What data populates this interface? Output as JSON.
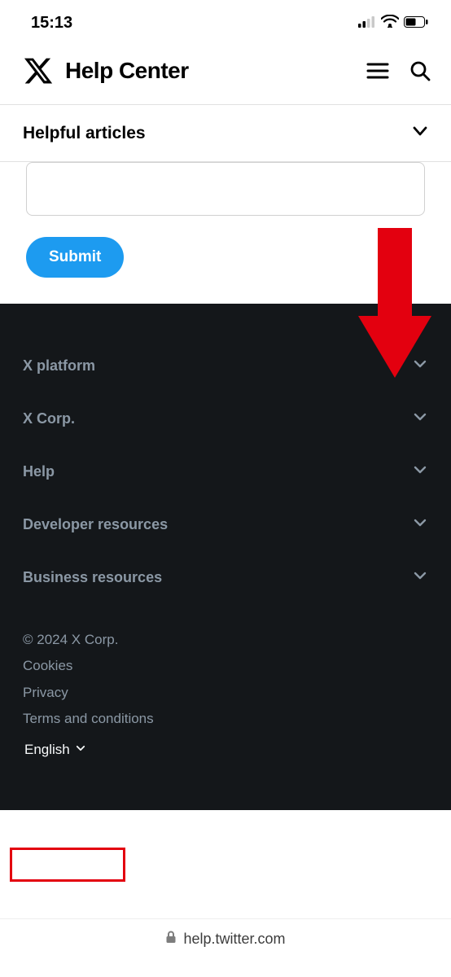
{
  "status": {
    "time": "15:13"
  },
  "header": {
    "title": "Help Center"
  },
  "subheader": {
    "title": "Helpful articles"
  },
  "form": {
    "submit_label": "Submit"
  },
  "footer": {
    "sections": [
      {
        "label": "X platform"
      },
      {
        "label": "X Corp."
      },
      {
        "label": "Help"
      },
      {
        "label": "Developer resources"
      },
      {
        "label": "Business resources"
      }
    ],
    "copyright": "© 2024 X Corp.",
    "links": [
      {
        "label": "Cookies"
      },
      {
        "label": "Privacy"
      },
      {
        "label": "Terms and conditions"
      }
    ],
    "language": "English"
  },
  "browser": {
    "url": "help.twitter.com"
  }
}
